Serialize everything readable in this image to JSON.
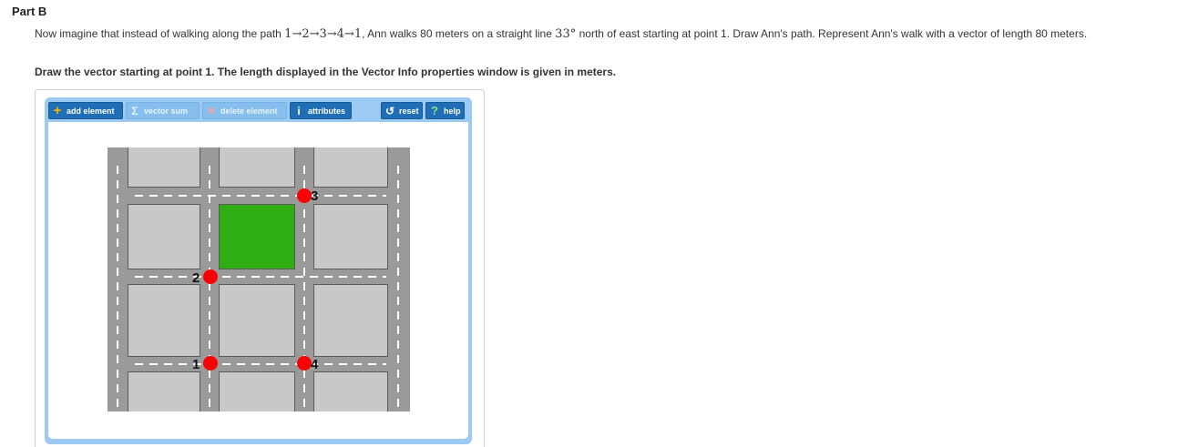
{
  "part": {
    "title": "Part B"
  },
  "question": {
    "text_before": "Now imagine that instead of walking along the path ",
    "path": "1→2→3→4→1",
    "text_mid": ", Ann walks 80 meters on a straight line ",
    "angle": "33°",
    "text_after": " north of east starting at point 1. Draw Ann's path. Represent Ann's walk with a vector of length 80 meters."
  },
  "instruction": "Draw the vector starting at point 1. The length displayed in the Vector Info properties window is given in meters.",
  "toolbar": {
    "add_label": "add element",
    "sum_label": "vector sum",
    "delete_label": "delete element",
    "attributes_label": "attributes",
    "reset_label": "reset",
    "help_label": "help"
  },
  "icons": {
    "add": "plus-icon",
    "sum": "sigma-icon",
    "delete": "x-icon",
    "attributes": "info-icon",
    "reset": "reset-icon",
    "help": "question-icon"
  },
  "map": {
    "points": [
      {
        "label": "1"
      },
      {
        "label": "2"
      },
      {
        "label": "3"
      },
      {
        "label": "4"
      }
    ]
  },
  "colors": {
    "button_active": "#1f6eb6",
    "button_disabled": "#86bfed",
    "panel": "#9ccaf2",
    "road": "#9a9a9a",
    "block": "#c8c8c8",
    "park": "#2fae13",
    "point": "#ff0000"
  }
}
